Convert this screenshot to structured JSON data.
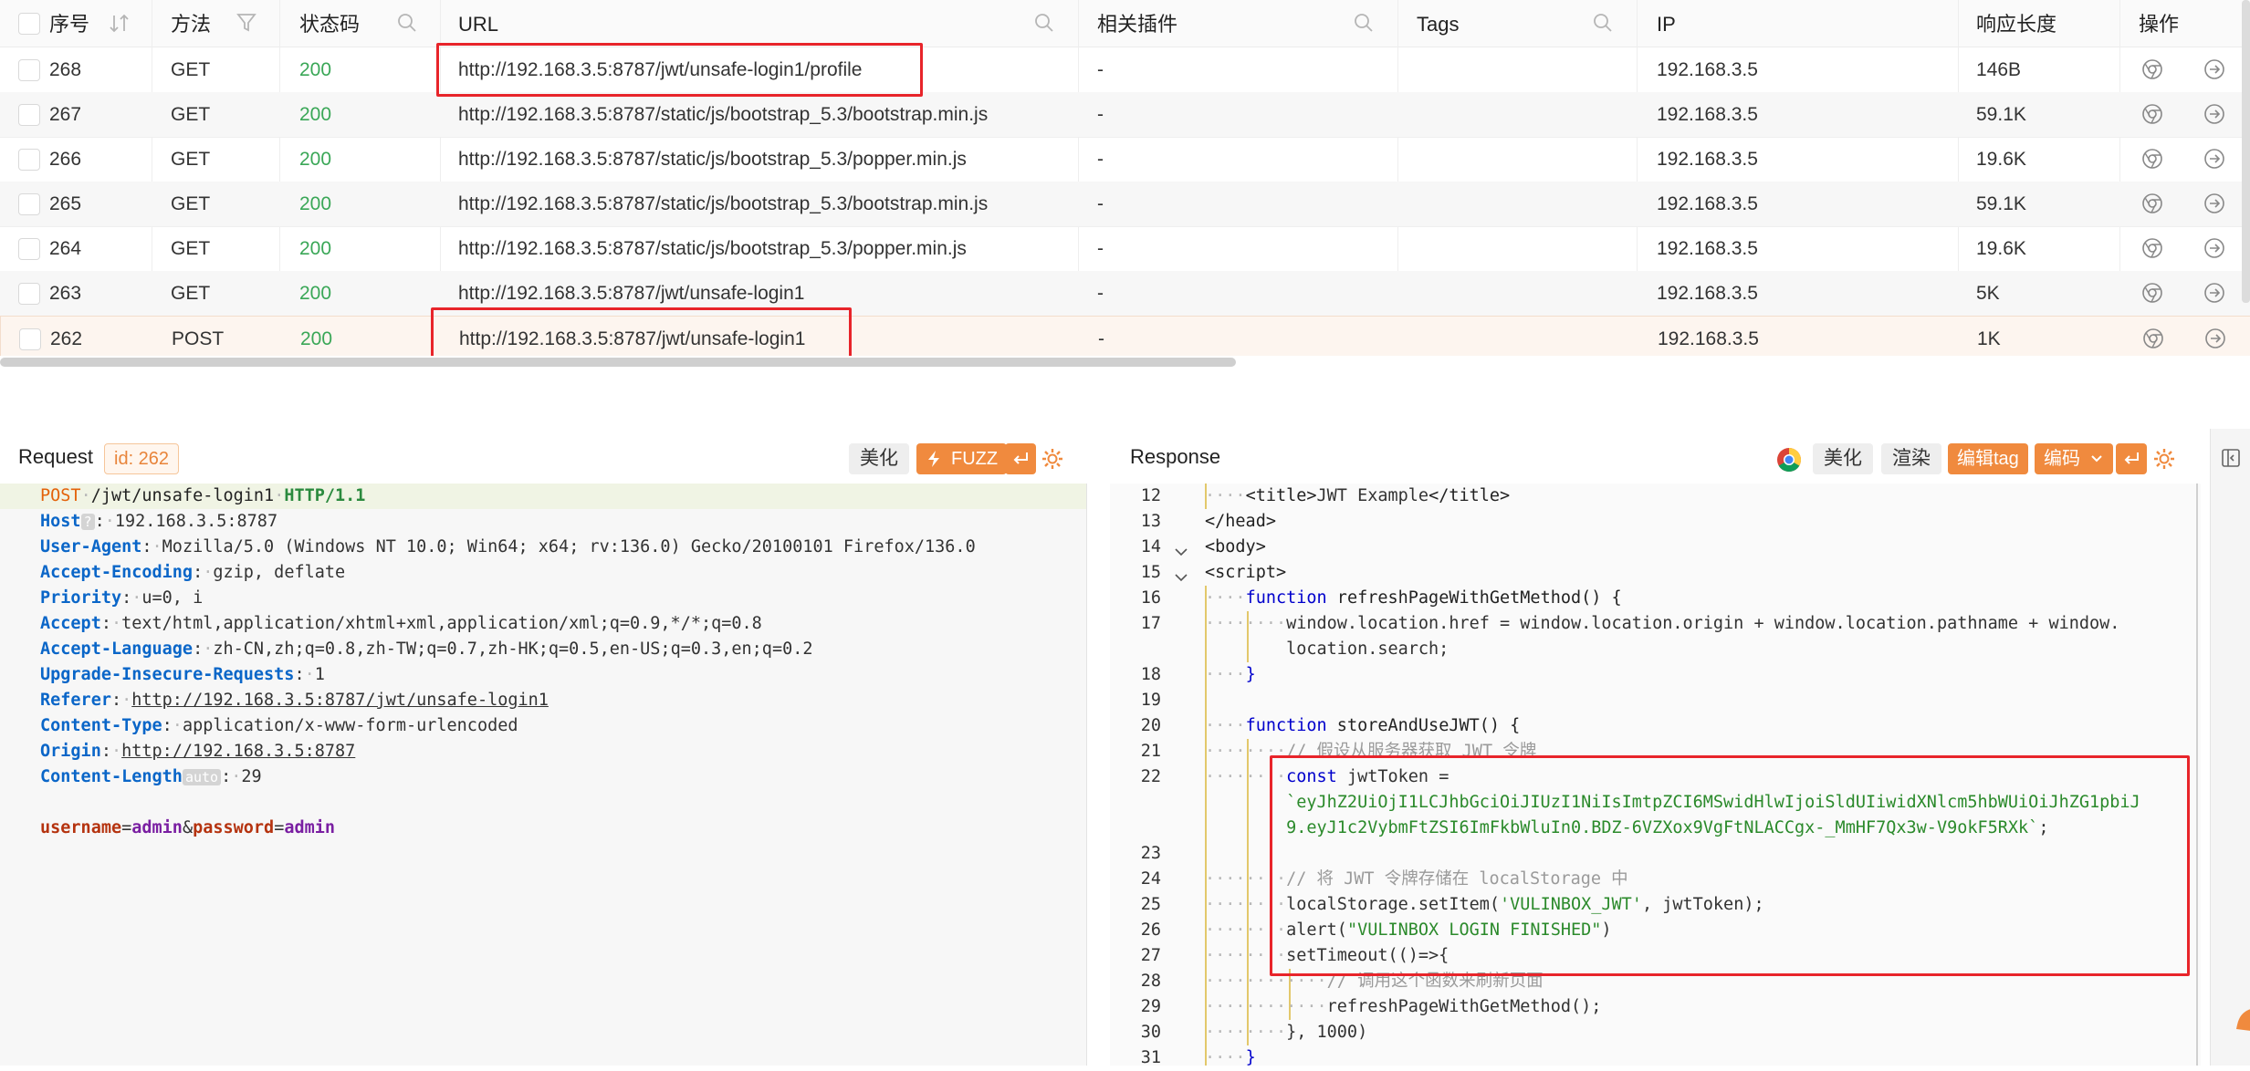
{
  "table": {
    "headers": {
      "seq": "序号",
      "method": "方法",
      "status": "状态码",
      "url": "URL",
      "plugin": "相关插件",
      "tags": "Tags",
      "ip": "IP",
      "length": "响应长度",
      "actions": "操作"
    },
    "rows": [
      {
        "id": "268",
        "method": "GET",
        "status": "200",
        "url": "http://192.168.3.5:8787/jwt/unsafe-login1/profile",
        "plugin": "-",
        "tags": "",
        "ip": "192.168.3.5",
        "length": "146B"
      },
      {
        "id": "267",
        "method": "GET",
        "status": "200",
        "url": "http://192.168.3.5:8787/static/js/bootstrap_5.3/bootstrap.min.js",
        "plugin": "-",
        "tags": "",
        "ip": "192.168.3.5",
        "length": "59.1K"
      },
      {
        "id": "266",
        "method": "GET",
        "status": "200",
        "url": "http://192.168.3.5:8787/static/js/bootstrap_5.3/popper.min.js",
        "plugin": "-",
        "tags": "",
        "ip": "192.168.3.5",
        "length": "19.6K"
      },
      {
        "id": "265",
        "method": "GET",
        "status": "200",
        "url": "http://192.168.3.5:8787/static/js/bootstrap_5.3/bootstrap.min.js",
        "plugin": "-",
        "tags": "",
        "ip": "192.168.3.5",
        "length": "59.1K"
      },
      {
        "id": "264",
        "method": "GET",
        "status": "200",
        "url": "http://192.168.3.5:8787/static/js/bootstrap_5.3/popper.min.js",
        "plugin": "-",
        "tags": "",
        "ip": "192.168.3.5",
        "length": "19.6K"
      },
      {
        "id": "263",
        "method": "GET",
        "status": "200",
        "url": "http://192.168.3.5:8787/jwt/unsafe-login1",
        "plugin": "-",
        "tags": "",
        "ip": "192.168.3.5",
        "length": "5K"
      },
      {
        "id": "262",
        "method": "POST",
        "status": "200",
        "url": "http://192.168.3.5:8787/jwt/unsafe-login1",
        "plugin": "-",
        "tags": "",
        "ip": "192.168.3.5",
        "length": "1K"
      }
    ]
  },
  "request": {
    "title": "Request",
    "id_tag": "id: 262",
    "beautify": "美化",
    "fuzz": "FUZZ",
    "lines": {
      "method": "POST",
      "path": "/jwt/unsafe-login1",
      "protocol": "HTTP/1.1",
      "host_k": "Host",
      "host_help": "?",
      "host_v": "192.168.3.5:8787",
      "ua_k": "User-Agent",
      "ua_v": "Mozilla/5.0 (Windows NT 10.0; Win64; x64; rv:136.0) Gecko/20100101 Firefox/136.0",
      "ae_k": "Accept-Encoding",
      "ae_v": "gzip, deflate",
      "pr_k": "Priority",
      "pr_v": "u=0, i",
      "ac_k": "Accept",
      "ac_v": "text/html,application/xhtml+xml,application/xml;q=0.9,*/*;q=0.8",
      "al_k": "Accept-Language",
      "al_v": "zh-CN,zh;q=0.8,zh-TW;q=0.7,zh-HK;q=0.5,en-US;q=0.3,en;q=0.2",
      "ui_k": "Upgrade-Insecure-Requests",
      "ui_v": "1",
      "rf_k": "Referer",
      "rf_v": "http://192.168.3.5:8787/jwt/unsafe-login1",
      "ct_k": "Content-Type",
      "ct_v": "application/x-www-form-urlencoded",
      "or_k": "Origin",
      "or_v": "http://192.168.3.5:8787",
      "cl_k": "Content-Length",
      "cl_auto": "auto",
      "cl_v": "29",
      "body_k1": "username",
      "body_v1": "admin",
      "body_k2": "password",
      "body_v2": "admin"
    }
  },
  "response": {
    "title": "Response",
    "beautify": "美化",
    "render": "渲染",
    "edit_tag": "编辑tag",
    "encode": "编码",
    "line_numbers": [
      "12",
      "13",
      "14",
      "15",
      "16",
      "17",
      "",
      "18",
      "19",
      "20",
      "21",
      "22",
      "",
      "",
      "23",
      "24",
      "25",
      "26",
      "27",
      "28",
      "29",
      "30",
      "31"
    ],
    "code": {
      "l12a": "<title>",
      "l12b": "JWT Example",
      "l12c": "</title>",
      "l13": "</head>",
      "l14": "<body>",
      "l15": "<script>",
      "l16a": "function",
      "l16b": " refreshPageWithGetMethod() {",
      "l17": "window.location.href = window.location.origin + window.location.pathname + window.",
      "l17b": "location.search;",
      "l18": "}",
      "l20a": "function",
      "l20b": " storeAndUseJWT() {",
      "l21": "// 假设从服务器获取 JWT 令牌",
      "l22a": "const",
      "l22b": " jwtToken =",
      "l22c": "`eyJhZ2UiOjI1LCJhbGciOiJIUzI1NiIsImtpZCI6MSwidHlwIjoiSldUIiwidXNlcm5hbWUiOiJhZG1pbiJ",
      "l22d": "9.eyJ1c2VybmFtZSI6ImFkbWluIn0.BDZ-6VZXox9VgFtNLACCgx-_MmHF7Qx3w-V9okF5RXk`",
      "l22e": ";",
      "l24": "// 将 JWT 令牌存储在 localStorage 中",
      "l25a": "localStorage.setItem(",
      "l25b": "'VULINBOX_JWT'",
      "l25c": ", jwtToken);",
      "l26a": "alert(",
      "l26b": "\"VULINBOX LOGIN FINISHED\"",
      "l26c": ")",
      "l27": "setTimeout(()=>{",
      "l28": "// 调用这个函数来刷新页面",
      "l29": "refreshPageWithGetMethod();",
      "l30": "}, 1000)",
      "l31": "}"
    }
  },
  "colors": {
    "accent_orange": "#f08a3e",
    "status_green": "#3aa757",
    "highlight_red": "#e8242a"
  }
}
